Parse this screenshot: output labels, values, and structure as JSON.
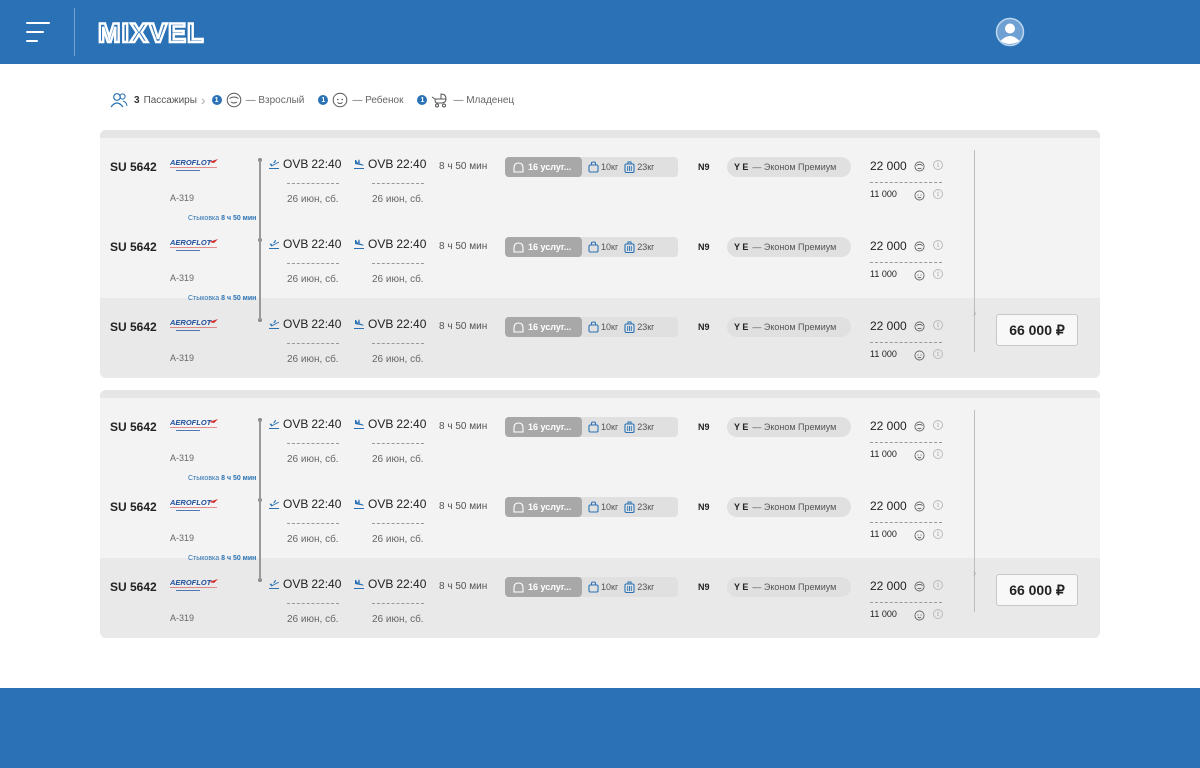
{
  "app": {
    "logo_text": "MIXVEL"
  },
  "colors": {
    "brand": "#2a72b5",
    "card_bg": "#f3f3f3",
    "service_badge": "#a8a8a8"
  },
  "passengers": {
    "total": "3",
    "label": "Пассажиры",
    "types": [
      {
        "count": "1",
        "label": "— Взрослый",
        "icon": "adult-face-icon"
      },
      {
        "count": "1",
        "label": "— Ребенок",
        "icon": "child-face-icon"
      },
      {
        "count": "1",
        "label": "— Младенец",
        "icon": "stroller-icon"
      }
    ]
  },
  "offers": [
    {
      "total_price": "66 000 ₽",
      "segments": [
        {
          "flight": "SU 5642",
          "aircraft": "A-319",
          "dep_code": "OVB",
          "dep_time": "22:40",
          "dep_date": "26 июн, сб.",
          "arr_code": "OVB",
          "arr_time": "22:40",
          "arr_date": "26 июн, сб.",
          "duration": "8 ч 50 мин",
          "services": "16 услуг...",
          "hand_bag": "10кг",
          "baggage": "23кг",
          "fare": "N9",
          "cabin_code": "Y E",
          "cabin_name": "— Эконом Премиум",
          "price_adult": "22 000",
          "price_child": "11 000",
          "transfer_label": "Стыковка",
          "transfer_time": "8 ч 50 мин"
        },
        {
          "flight": "SU 5642",
          "aircraft": "A-319",
          "dep_code": "OVB",
          "dep_time": "22:40",
          "dep_date": "26 июн, сб.",
          "arr_code": "OVB",
          "arr_time": "22:40",
          "arr_date": "26 июн, сб.",
          "duration": "8 ч 50 мин",
          "services": "16 услуг...",
          "hand_bag": "10кг",
          "baggage": "23кг",
          "fare": "N9",
          "cabin_code": "Y E",
          "cabin_name": "— Эконом Премиум",
          "price_adult": "22 000",
          "price_child": "11 000",
          "transfer_label": "Стыковка",
          "transfer_time": "8 ч 50 мин"
        },
        {
          "flight": "SU 5642",
          "aircraft": "A-319",
          "dep_code": "OVB",
          "dep_time": "22:40",
          "dep_date": "26 июн, сб.",
          "arr_code": "OVB",
          "arr_time": "22:40",
          "arr_date": "26 июн, сб.",
          "duration": "8 ч 50 мин",
          "services": "16 услуг...",
          "hand_bag": "10кг",
          "baggage": "23кг",
          "fare": "N9",
          "cabin_code": "Y E",
          "cabin_name": "— Эконом Премиум",
          "price_adult": "22 000",
          "price_child": "11 000"
        }
      ]
    },
    {
      "total_price": "66 000 ₽",
      "segments": [
        {
          "flight": "SU 5642",
          "aircraft": "A-319",
          "dep_code": "OVB",
          "dep_time": "22:40",
          "dep_date": "26 июн, сб.",
          "arr_code": "OVB",
          "arr_time": "22:40",
          "arr_date": "26 июн, сб.",
          "duration": "8 ч 50 мин",
          "services": "16 услуг...",
          "hand_bag": "10кг",
          "baggage": "23кг",
          "fare": "N9",
          "cabin_code": "Y E",
          "cabin_name": "— Эконом Премиум",
          "price_adult": "22 000",
          "price_child": "11 000",
          "transfer_label": "Стыковка",
          "transfer_time": "8 ч 50 мин"
        },
        {
          "flight": "SU 5642",
          "aircraft": "A-319",
          "dep_code": "OVB",
          "dep_time": "22:40",
          "dep_date": "26 июн, сб.",
          "arr_code": "OVB",
          "arr_time": "22:40",
          "arr_date": "26 июн, сб.",
          "duration": "8 ч 50 мин",
          "services": "16 услуг...",
          "hand_bag": "10кг",
          "baggage": "23кг",
          "fare": "N9",
          "cabin_code": "Y E",
          "cabin_name": "— Эконом Премиум",
          "price_adult": "22 000",
          "price_child": "11 000",
          "transfer_label": "Стыковка",
          "transfer_time": "8 ч 50 мин"
        },
        {
          "flight": "SU 5642",
          "aircraft": "A-319",
          "dep_code": "OVB",
          "dep_time": "22:40",
          "dep_date": "26 июн, сб.",
          "arr_code": "OVB",
          "arr_time": "22:40",
          "arr_date": "26 июн, сб.",
          "duration": "8 ч 50 мин",
          "services": "16 услуг...",
          "hand_bag": "10кг",
          "baggage": "23кг",
          "fare": "N9",
          "cabin_code": "Y E",
          "cabin_name": "— Эконом Премиум",
          "price_adult": "22 000",
          "price_child": "11 000"
        }
      ]
    }
  ]
}
